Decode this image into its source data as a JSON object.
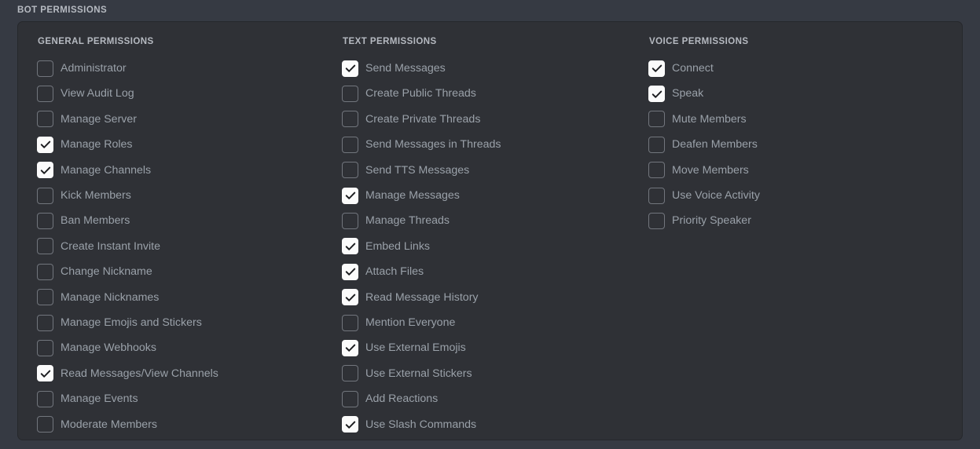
{
  "section": {
    "title": "BOT PERMISSIONS"
  },
  "colors": {
    "page_background": "#363a43",
    "card_background": "#2f3136",
    "card_border": "#26282c",
    "heading_text": "#b6bac1",
    "label_text": "#9aa1a9",
    "checkbox_border": "#72767d",
    "checkbox_checked_fill": "#fbfbfb",
    "checkmark": "#1c1d20"
  },
  "columns": [
    {
      "key": "general",
      "title": "GENERAL PERMISSIONS",
      "items": [
        {
          "label": "Administrator",
          "checked": false
        },
        {
          "label": "View Audit Log",
          "checked": false
        },
        {
          "label": "Manage Server",
          "checked": false
        },
        {
          "label": "Manage Roles",
          "checked": true
        },
        {
          "label": "Manage Channels",
          "checked": true
        },
        {
          "label": "Kick Members",
          "checked": false
        },
        {
          "label": "Ban Members",
          "checked": false
        },
        {
          "label": "Create Instant Invite",
          "checked": false
        },
        {
          "label": "Change Nickname",
          "checked": false
        },
        {
          "label": "Manage Nicknames",
          "checked": false
        },
        {
          "label": "Manage Emojis and Stickers",
          "checked": false
        },
        {
          "label": "Manage Webhooks",
          "checked": false
        },
        {
          "label": "Read Messages/View Channels",
          "checked": true
        },
        {
          "label": "Manage Events",
          "checked": false
        },
        {
          "label": "Moderate Members",
          "checked": false
        }
      ]
    },
    {
      "key": "text",
      "title": "TEXT PERMISSIONS",
      "items": [
        {
          "label": "Send Messages",
          "checked": true
        },
        {
          "label": "Create Public Threads",
          "checked": false
        },
        {
          "label": "Create Private Threads",
          "checked": false
        },
        {
          "label": "Send Messages in Threads",
          "checked": false
        },
        {
          "label": "Send TTS Messages",
          "checked": false
        },
        {
          "label": "Manage Messages",
          "checked": true
        },
        {
          "label": "Manage Threads",
          "checked": false
        },
        {
          "label": "Embed Links",
          "checked": true
        },
        {
          "label": "Attach Files",
          "checked": true
        },
        {
          "label": "Read Message History",
          "checked": true
        },
        {
          "label": "Mention Everyone",
          "checked": false
        },
        {
          "label": "Use External Emojis",
          "checked": true
        },
        {
          "label": "Use External Stickers",
          "checked": false
        },
        {
          "label": "Add Reactions",
          "checked": false
        },
        {
          "label": "Use Slash Commands",
          "checked": true
        }
      ]
    },
    {
      "key": "voice",
      "title": "VOICE PERMISSIONS",
      "items": [
        {
          "label": "Connect",
          "checked": true
        },
        {
          "label": "Speak",
          "checked": true
        },
        {
          "label": "Mute Members",
          "checked": false
        },
        {
          "label": "Deafen Members",
          "checked": false
        },
        {
          "label": "Move Members",
          "checked": false
        },
        {
          "label": "Use Voice Activity",
          "checked": false
        },
        {
          "label": "Priority Speaker",
          "checked": false
        }
      ]
    }
  ]
}
